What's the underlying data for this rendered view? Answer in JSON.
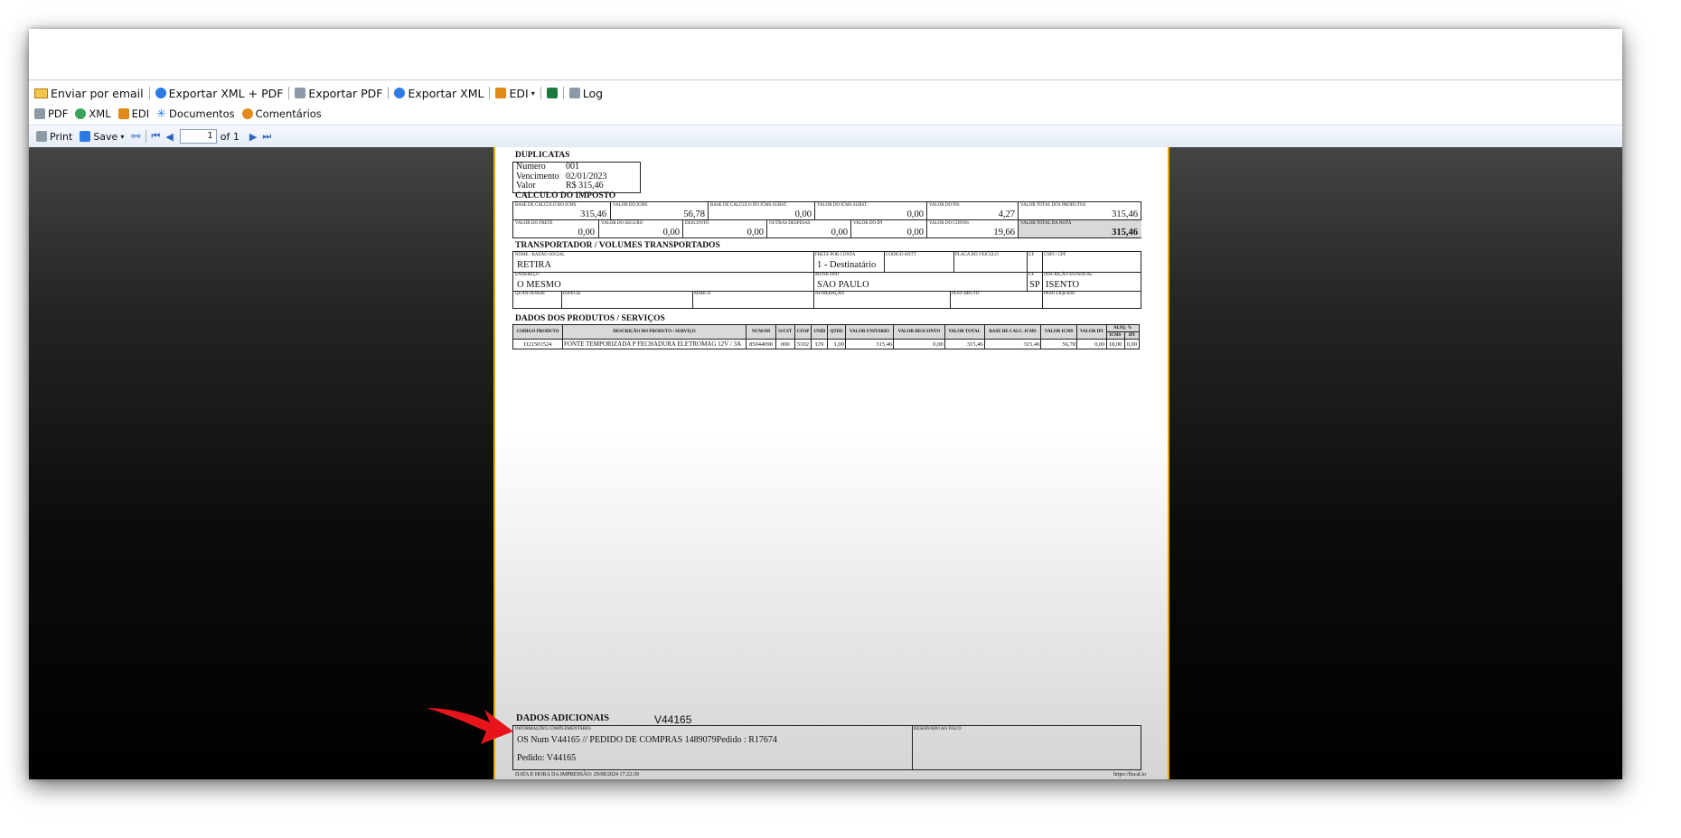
{
  "toolbar1": [
    {
      "icon": "envelope-icon",
      "label": "Enviar por email"
    },
    {
      "icon": "xml-pdf-export-icon",
      "label": "Exportar XML + PDF"
    },
    {
      "icon": "pdf-export-icon",
      "label": "Exportar PDF"
    },
    {
      "icon": "xml-export-icon",
      "label": "Exportar XML"
    },
    {
      "icon": "truck-icon",
      "label": "EDI"
    },
    {
      "icon": "excel-icon",
      "label": ""
    },
    {
      "icon": "log-icon",
      "label": "Log"
    }
  ],
  "toolbar2": [
    {
      "icon": "printer-icon",
      "label": "PDF"
    },
    {
      "icon": "xml-icon",
      "label": "XML"
    },
    {
      "icon": "truck-icon",
      "label": "EDI"
    },
    {
      "icon": "sparkle-icon",
      "label": "Documentos"
    },
    {
      "icon": "comment-icon",
      "label": "Comentários"
    }
  ],
  "viewer_toolbar": {
    "print": "Print",
    "save": "Save",
    "page": "1",
    "of": "of 1"
  },
  "doc": {
    "duplicatas": {
      "title": "DUPLICATAS",
      "numero_label": "Numero",
      "numero": "001",
      "vencimento_label": "Vencimento",
      "vencimento": "02/01/2023",
      "valor_label": "Valor",
      "valor": "R$ 315,46"
    },
    "imposto": {
      "title": "CALCULO DO IMPOSTO",
      "row1": [
        {
          "label": "BASE DE CALCULO DO ICMS",
          "value": "315,46"
        },
        {
          "label": "VALOR DO ICMS",
          "value": "56,78"
        },
        {
          "label": "BASE DE CALCULO DO ICMS SUBST.",
          "value": "0,00"
        },
        {
          "label": "VALOR DO ICMS SUBST.",
          "value": "0,00"
        },
        {
          "label": "VALOR DO PIS",
          "value": "4,27"
        },
        {
          "label": "VALOR TOTAL DOS PRODUTOS",
          "value": "315,46"
        }
      ],
      "row2": [
        {
          "label": "VALOR DO FRETE",
          "value": "0,00"
        },
        {
          "label": "VALOR DO SEGURO",
          "value": "0,00"
        },
        {
          "label": "DESCONTO",
          "value": "0,00"
        },
        {
          "label": "OUTRAS DESPESAS",
          "value": "0,00"
        },
        {
          "label": "VALOR DO IPI",
          "value": "0,00"
        },
        {
          "label": "VALOR DO COFINS",
          "value": "19,66"
        },
        {
          "label": "VALOR TOTAL DA NOTA",
          "value": "315,46"
        }
      ]
    },
    "transp": {
      "title": "TRANSPORTADOR / VOLUMES TRANSPORTADOS",
      "nome_label": "NOME / RAZÃO SOCIAL",
      "nome": "RETIRA",
      "frete_label": "FRETE POR CONTA",
      "frete": "1 - Destinatário",
      "antt_label": "CODIGO ANTT",
      "placa_label": "PLACA DO VEICULO",
      "uf_label": "UF",
      "cnpj_label": "CNPJ / CPF",
      "endereco_label": "ENDEREÇO",
      "endereco": "O MESMO",
      "municipio_label": "MUNICIPIO",
      "municipio": "SAO PAULO",
      "uf2_label": "UF",
      "uf2": "SP",
      "ie_label": "INSCRIÇÃO ESTADUAL",
      "ie": "ISENTO",
      "qtd_label": "QUANTIDADE",
      "especie_label": "ESPECIE",
      "marca_label": "MARCA",
      "numeracao_label": "NUMERAÇÃO",
      "bruto_label": "PESO BRUTO",
      "liquido_label": "PESO LIQUIDO"
    },
    "produtos": {
      "title": "DADOS DOS PRODUTOS / SERVIÇOS",
      "headers": [
        "CODIGO PRODUTO",
        "DESCRIÇÃO DO PRODUTO / SERVIÇO",
        "NCM/SH",
        "O/CST",
        "CFOP",
        "UNID",
        "QTDE",
        "VALOR UNITARIO",
        "VALOR DESCONTO",
        "VALOR TOTAL",
        "BASE DE CALC. ICMS",
        "VALOR ICMS",
        "VALOR IPI",
        "ALIQ. % ICMS",
        "ALIQ. % IPI"
      ],
      "aliq_label": "ALIQ. %",
      "aliq_icms": "ICMS",
      "aliq_ipi": "IPI",
      "row": [
        "D21501524",
        "FONTE TEMPORIZADA P FECHADURA ELETROMAG 12V / 3A",
        "85044090",
        "000",
        "5102",
        "UN",
        "1,00",
        "315,46",
        "0,00",
        "315,46",
        "315,46",
        "56,78",
        "0,00",
        "18,00",
        "0,00"
      ]
    },
    "adicionais": {
      "title": "DADOS ADICIONAIS",
      "code": "V44165",
      "info_label": "INFORMAÇÕES COMPLEMENTARES",
      "info_line1": "OS Num V44165 // PEDIDO DE COMPRAS 1489079Pedido  : R17674",
      "info_line2": "Pedido: V44165",
      "fisco_label": "RESERVADO AO FISCO",
      "footer_left": "DATA E HORA DA IMPRESSÃO: 29/08/2024 17:22:39",
      "footer_right": "https://fiscal.io"
    }
  },
  "colors": {
    "doc_border": "#e4a700",
    "arrow": "#e8141b",
    "viewer_bg": "#000000"
  }
}
